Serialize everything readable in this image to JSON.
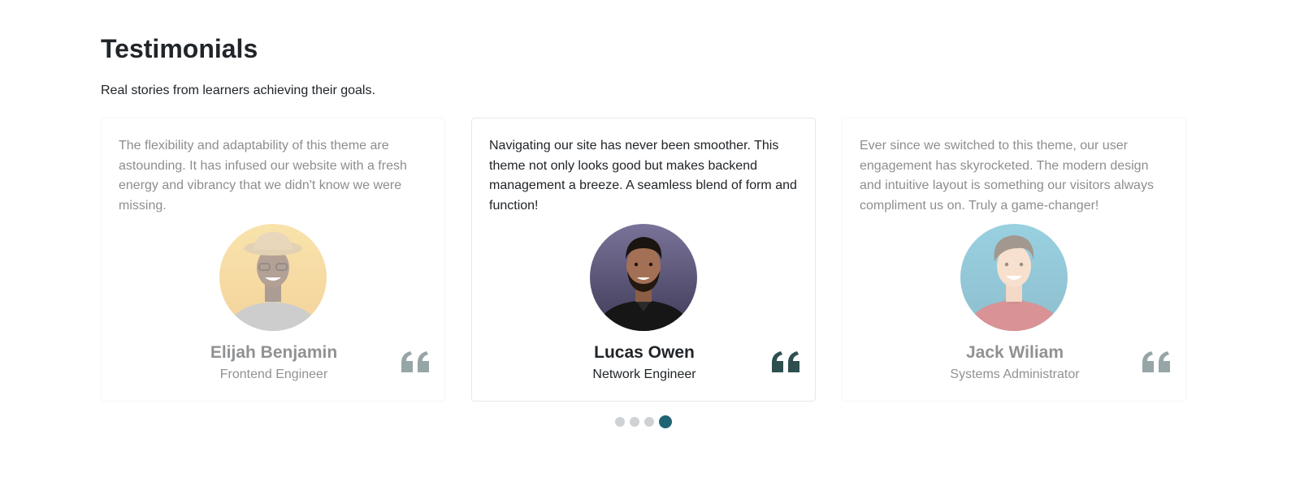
{
  "header": {
    "title": "Testimonials",
    "subtitle": "Real stories from learners achieving their goals."
  },
  "testimonials": [
    {
      "quote": "The flexibility and adaptability of this theme are astounding. It has infused our website with a fresh energy and vibrancy that we didn't know we were missing.",
      "name": "Elijah Benjamin",
      "role": "Frontend Engineer",
      "avatar_bg": "#f2c35a",
      "state": "inactive"
    },
    {
      "quote": "Navigating our site has never been smoother. This theme not only looks good but makes backend management a breeze. A seamless blend of form and function!",
      "name": "Lucas Owen",
      "role": "Network Engineer",
      "avatar_bg": "#5a5577",
      "state": "active"
    },
    {
      "quote": "Ever since we switched to this theme, our user engagement has skyrocketed. The modern design and intuitive layout is something our visitors always compliment us on. Truly a game-changer!",
      "name": "Jack Wiliam",
      "role": "Systems Administrator",
      "avatar_bg": "#2f98b8",
      "state": "inactive"
    }
  ],
  "icons": {
    "quote": "quote-icon",
    "avatar": "avatar"
  },
  "pagination": {
    "count": 4,
    "active_index": 3
  },
  "colors": {
    "text": "#212529",
    "quote_icon": "#2f4f4f",
    "dot_inactive": "#cfd2d4",
    "dot_active": "#1f6475",
    "card_border": "#eceef0"
  }
}
